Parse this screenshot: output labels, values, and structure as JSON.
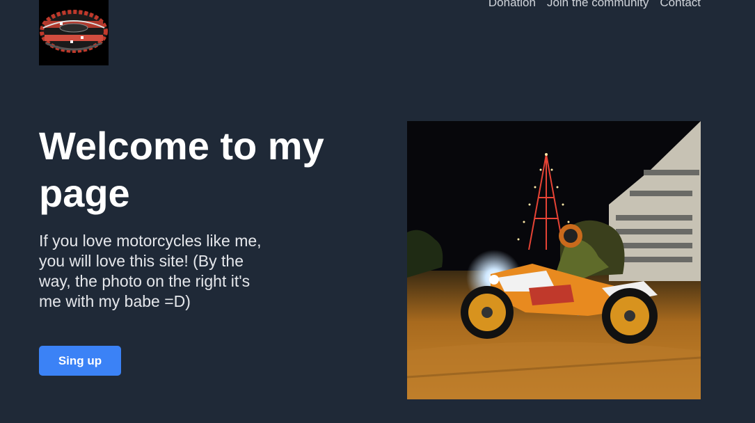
{
  "header": {
    "logo_alt": "helmet logo",
    "nav": [
      {
        "label": "Donation"
      },
      {
        "label": "Join the community"
      },
      {
        "label": "Contact"
      }
    ]
  },
  "hero": {
    "title": "Welcome to my page",
    "description": "If you love motorcycles like me, you will love this site! (By the way, the photo on the right it's me with my babe =D)",
    "cta_label": "Sing up",
    "photo_alt": "motorcycle rider at night"
  },
  "colors": {
    "background": "#1f2937",
    "accent": "#3b82f6",
    "text": "#ffffff",
    "muted_text": "#d1d5db"
  }
}
